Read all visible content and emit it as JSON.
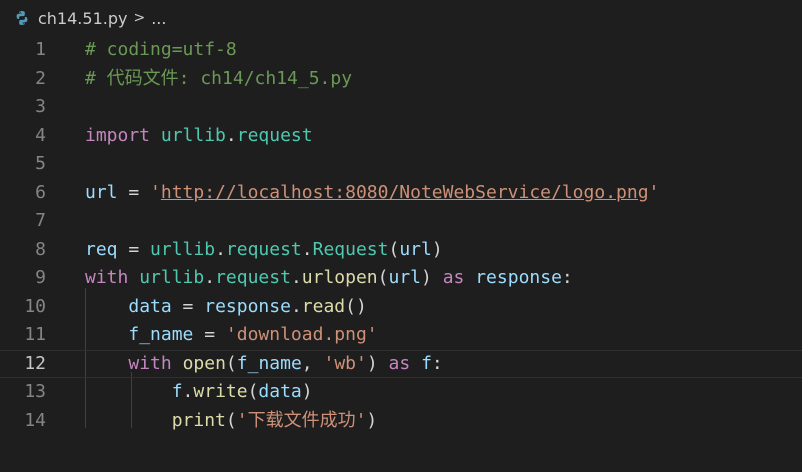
{
  "breadcrumb": {
    "file": "ch14.51.py",
    "separator": ">",
    "more": "..."
  },
  "editor": {
    "current_line": 12,
    "lines": [
      {
        "n": "1",
        "tokens": [
          {
            "t": "# coding=utf-8",
            "c": "comment"
          }
        ]
      },
      {
        "n": "2",
        "tokens": [
          {
            "t": "# 代码文件: ch14/ch14_5.py",
            "c": "comment"
          }
        ]
      },
      {
        "n": "3",
        "tokens": []
      },
      {
        "n": "4",
        "tokens": [
          {
            "t": "import",
            "c": "kw"
          },
          {
            "t": " ",
            "c": "op"
          },
          {
            "t": "urllib",
            "c": "ns"
          },
          {
            "t": ".",
            "c": "op"
          },
          {
            "t": "request",
            "c": "ns"
          }
        ]
      },
      {
        "n": "5",
        "tokens": []
      },
      {
        "n": "6",
        "tokens": [
          {
            "t": "url",
            "c": "var"
          },
          {
            "t": " = ",
            "c": "op"
          },
          {
            "t": "'",
            "c": "str"
          },
          {
            "t": "http://localhost:8080/NoteWebService/logo.png",
            "c": "url"
          },
          {
            "t": "'",
            "c": "str"
          }
        ]
      },
      {
        "n": "7",
        "tokens": []
      },
      {
        "n": "8",
        "tokens": [
          {
            "t": "req",
            "c": "var"
          },
          {
            "t": " = ",
            "c": "op"
          },
          {
            "t": "urllib",
            "c": "ns"
          },
          {
            "t": ".",
            "c": "op"
          },
          {
            "t": "request",
            "c": "ns"
          },
          {
            "t": ".",
            "c": "op"
          },
          {
            "t": "Request",
            "c": "ns"
          },
          {
            "t": "(",
            "c": "op"
          },
          {
            "t": "url",
            "c": "var"
          },
          {
            "t": ")",
            "c": "op"
          }
        ]
      },
      {
        "n": "9",
        "tokens": [
          {
            "t": "with",
            "c": "kw"
          },
          {
            "t": " ",
            "c": "op"
          },
          {
            "t": "urllib",
            "c": "ns"
          },
          {
            "t": ".",
            "c": "op"
          },
          {
            "t": "request",
            "c": "ns"
          },
          {
            "t": ".",
            "c": "op"
          },
          {
            "t": "urlopen",
            "c": "fn"
          },
          {
            "t": "(",
            "c": "op"
          },
          {
            "t": "url",
            "c": "var"
          },
          {
            "t": ") ",
            "c": "op"
          },
          {
            "t": "as",
            "c": "kw"
          },
          {
            "t": " ",
            "c": "op"
          },
          {
            "t": "response",
            "c": "var"
          },
          {
            "t": ":",
            "c": "op"
          }
        ]
      },
      {
        "n": "10",
        "tokens": [
          {
            "t": "    ",
            "c": "op"
          },
          {
            "t": "data",
            "c": "var"
          },
          {
            "t": " = ",
            "c": "op"
          },
          {
            "t": "response",
            "c": "var"
          },
          {
            "t": ".",
            "c": "op"
          },
          {
            "t": "read",
            "c": "fn"
          },
          {
            "t": "()",
            "c": "op"
          }
        ]
      },
      {
        "n": "11",
        "tokens": [
          {
            "t": "    ",
            "c": "op"
          },
          {
            "t": "f_name",
            "c": "var"
          },
          {
            "t": " = ",
            "c": "op"
          },
          {
            "t": "'download.png'",
            "c": "str"
          }
        ]
      },
      {
        "n": "12",
        "tokens": [
          {
            "t": "    ",
            "c": "op"
          },
          {
            "t": "with",
            "c": "kw"
          },
          {
            "t": " ",
            "c": "op"
          },
          {
            "t": "open",
            "c": "fn"
          },
          {
            "t": "(",
            "c": "op"
          },
          {
            "t": "f_name",
            "c": "var"
          },
          {
            "t": ", ",
            "c": "op"
          },
          {
            "t": "'wb'",
            "c": "str"
          },
          {
            "t": ") ",
            "c": "op"
          },
          {
            "t": "as",
            "c": "kw"
          },
          {
            "t": " ",
            "c": "op"
          },
          {
            "t": "f",
            "c": "var"
          },
          {
            "t": ":",
            "c": "op"
          }
        ]
      },
      {
        "n": "13",
        "tokens": [
          {
            "t": "        ",
            "c": "op"
          },
          {
            "t": "f",
            "c": "var"
          },
          {
            "t": ".",
            "c": "op"
          },
          {
            "t": "write",
            "c": "fn"
          },
          {
            "t": "(",
            "c": "op"
          },
          {
            "t": "data",
            "c": "var"
          },
          {
            "t": ")",
            "c": "op"
          }
        ]
      },
      {
        "n": "14",
        "tokens": [
          {
            "t": "        ",
            "c": "op"
          },
          {
            "t": "print",
            "c": "fn"
          },
          {
            "t": "(",
            "c": "op"
          },
          {
            "t": "'下载文件成功'",
            "c": "str"
          },
          {
            "t": ")",
            "c": "op"
          }
        ]
      }
    ]
  },
  "colors": {
    "background": "#1e1e1e",
    "comment": "#6a9955",
    "keyword": "#c586c0",
    "namespace": "#4ec9b0",
    "variable": "#9cdcfe",
    "function": "#dcdcaa",
    "string": "#ce9178",
    "line_number": "#858585"
  },
  "icons": {
    "file_icon": "python-icon",
    "separator_icon": "chevron-right-icon"
  }
}
